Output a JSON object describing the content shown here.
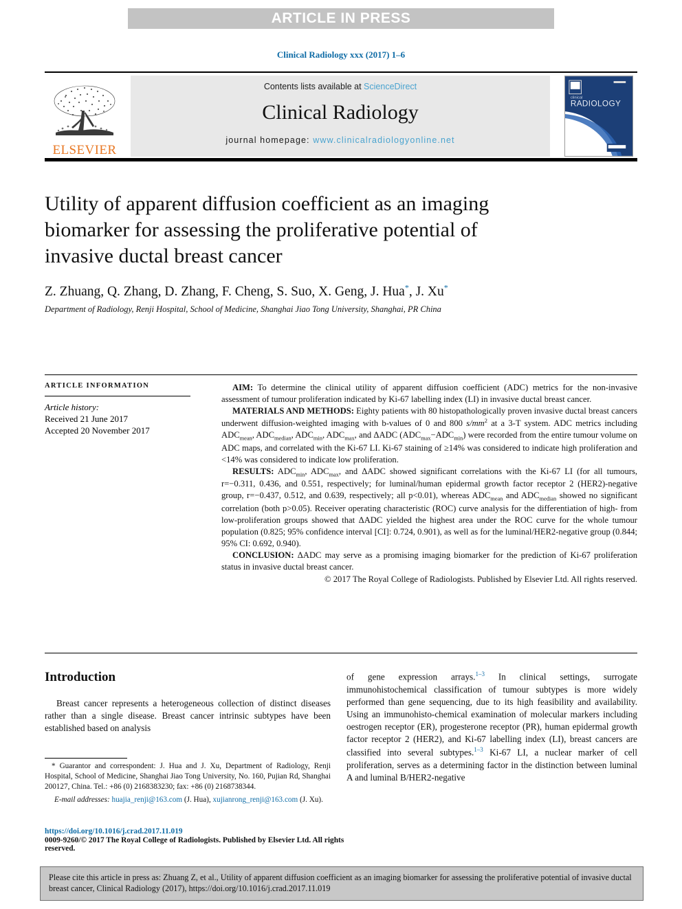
{
  "banner": {
    "text": "ARTICLE IN PRESS"
  },
  "journal_line": {
    "text": "Clinical Radiology xxx (2017) 1–6"
  },
  "masthead": {
    "contents_prefix": "Contents lists available at ",
    "contents_link": "ScienceDirect",
    "journal_title": "Clinical Radiology",
    "homepage_prefix": "journal homepage: ",
    "homepage_url": "www.clinicalradiologyonline.net",
    "publisher_logo_text": "ELSEVIER",
    "cover_title_small": "clinical",
    "cover_title_large": "RADIOLOGY"
  },
  "article": {
    "title": "Utility of apparent diffusion coefficient as an imaging biomarker for assessing the proliferative potential of invasive ductal breast cancer",
    "authors": "Z. Zhuang, Q. Zhang, D. Zhang, F. Cheng, S. Suo, X. Geng, J. Hua*, J. Xu*",
    "affiliation": "Department of Radiology, Renji Hospital, School of Medicine, Shanghai Jiao Tong University, Shanghai, PR China"
  },
  "article_information": {
    "heading": "ARTICLE INFORMATION",
    "history_label": "Article history:",
    "received": "Received 21 June 2017",
    "accepted": "Accepted 20 November 2017"
  },
  "abstract": {
    "aim": "AIM: To determine the clinical utility of apparent diffusion coefficient (ADC) metrics for the non-invasive assessment of tumour proliferation indicated by Ki-67 labelling index (LI) in invasive ductal breast cancer.",
    "materials_methods": "MATERIALS AND METHODS: Eighty patients with 80 histopathologically proven invasive ductal breast cancers underwent diffusion-weighted imaging with b-values of 0 and 800 s/mm2 at a 3-T system. ADC metrics including ADCmean, ADCmedian, ADCmin, ADCmax, and ΔADC (ADCmax−ADCmin) were recorded from the entire tumour volume on ADC maps, and correlated with the Ki-67 LI. Ki-67 staining of ≥14% was considered to indicate high proliferation and <14% was considered to indicate low proliferation.",
    "results": "RESULTS: ADCmin, ADCmax, and ΔADC showed significant correlations with the Ki-67 LI (for all tumours, r=−0.311, 0.436, and 0.551, respectively; for luminal/human epidermal growth factor receptor 2 (HER2)-negative group, r=−0.437, 0.512, and 0.639, respectively; all p<0.01), whereas ADCmean and ADCmedian showed no significant correlation (both p>0.05). Receiver operating characteristic (ROC) curve analysis for the differentiation of high- from low-proliferation groups showed that ΔADC yielded the highest area under the ROC curve for the whole tumour population (0.825; 95% confidence interval [CI]: 0.724, 0.901), as well as for the luminal/HER2-negative group (0.844; 95% CI: 0.692, 0.940).",
    "conclusion": "CONCLUSION: ΔADC may serve as a promising imaging biomarker for the prediction of Ki-67 proliferation status in invasive ductal breast cancer.",
    "copyright": "© 2017 The Royal College of Radiologists. Published by Elsevier Ltd. All rights reserved."
  },
  "introduction": {
    "heading": "Introduction",
    "left_paragraph": "Breast cancer represents a heterogeneous collection of distinct diseases rather than a single disease. Breast cancer intrinsic subtypes have been established based on analysis",
    "right_paragraph_a": "of gene expression arrays.",
    "right_ref_a": "1–3",
    "right_paragraph_b": " In clinical settings, surrogate immunohistochemical classification of tumour subtypes is more widely performed than gene sequencing, due to its high feasibility and availability. Using an immunohisto-chemical examination of molecular markers including oestrogen receptor (ER), progesterone receptor (PR), human epidermal growth factor receptor 2 (HER2), and Ki-67 labelling index (LI), breast cancers are classified into several subtypes.",
    "right_ref_b": "1–3",
    "right_paragraph_c": " Ki-67 LI, a nuclear marker of cell proliferation, serves as a determining factor in the distinction between luminal A and luminal B/HER2-negative"
  },
  "footnote": {
    "guarantor": "* Guarantor and correspondent: J. Hua and J. Xu, Department of Radiology, Renji Hospital, School of Medicine, Shanghai Jiao Tong University, No. 160, Pujian Rd, Shanghai 200127, China. Tel.: +86 (0) 2168383230; fax: +86 (0) 2168738344.",
    "email_label": "E-mail addresses:",
    "email_1": "huajia_renji@163.com",
    "email_1_owner": " (J. Hua), ",
    "email_2": "xujianrong_renji@163.com",
    "email_2_owner": " (J. Xu)."
  },
  "doi_block": {
    "doi": "https://doi.org/10.1016/j.crad.2017.11.019",
    "issn_copyright": "0009-9260/© 2017 The Royal College of Radiologists. Published by Elsevier Ltd. All rights reserved."
  },
  "cite_box": {
    "text": "Please cite this article in press as: Zhuang Z, et al., Utility of apparent diffusion coefficient as an imaging biomarker for assessing the proliferative potential of invasive ductal breast cancer, Clinical Radiology (2017), https://doi.org/10.1016/j.crad.2017.11.019"
  },
  "colors": {
    "link": "#0f6ca6",
    "banner_bg": "#c3c3c3",
    "masthead_bg": "#e8e8e8",
    "elsevier_orange": "#e87722",
    "cite_bg": "#c8c8c8"
  }
}
